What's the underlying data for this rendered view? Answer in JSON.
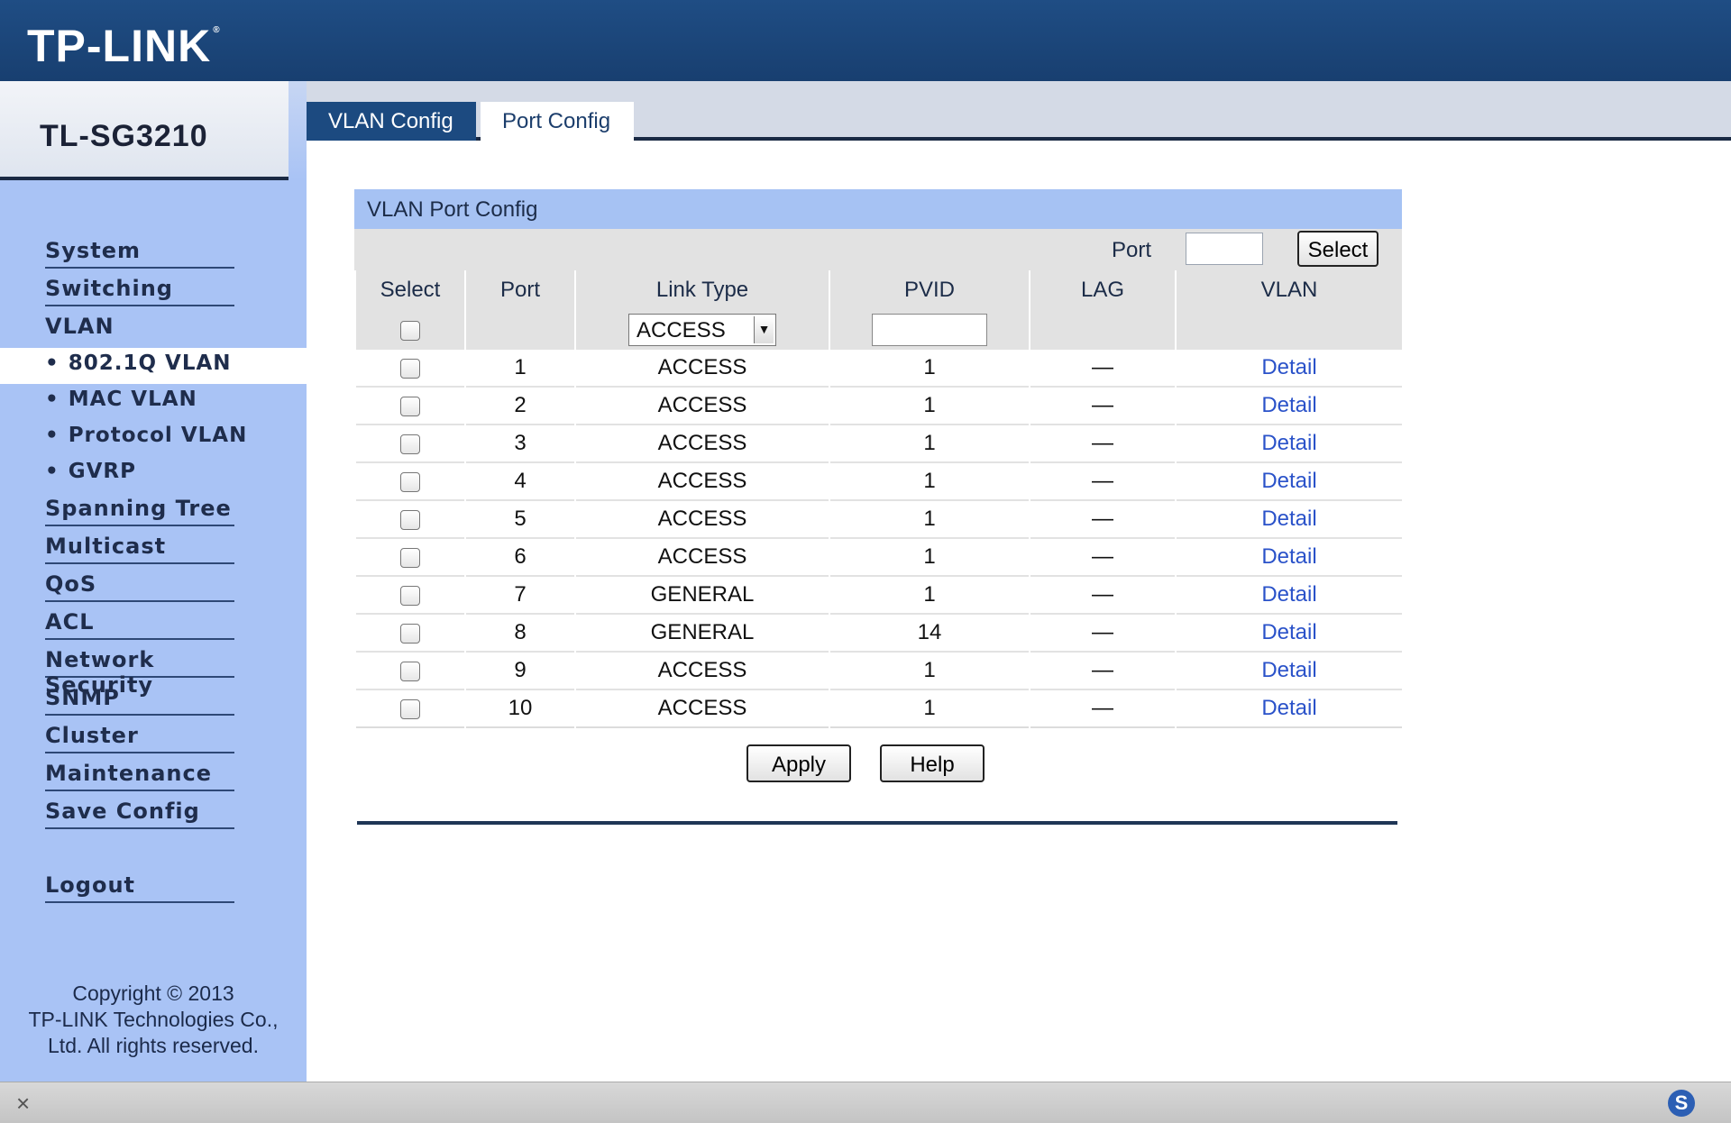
{
  "header": {
    "logo": "TP-LINK",
    "logo_mark": "®"
  },
  "sidebar": {
    "model": "TL-SG3210",
    "items": [
      {
        "label": "System"
      },
      {
        "label": "Switching"
      },
      {
        "label": "VLAN"
      },
      {
        "label": "Spanning Tree"
      },
      {
        "label": "Multicast"
      },
      {
        "label": "QoS"
      },
      {
        "label": "ACL"
      },
      {
        "label": "Network Security"
      },
      {
        "label": "SNMP"
      },
      {
        "label": "Cluster"
      },
      {
        "label": "Maintenance"
      },
      {
        "label": "Save Config"
      },
      {
        "label": "Logout"
      }
    ],
    "subitems": [
      {
        "label": "802.1Q VLAN",
        "active": true
      },
      {
        "label": "MAC VLAN"
      },
      {
        "label": "Protocol VLAN"
      },
      {
        "label": "GVRP"
      }
    ],
    "bullet": "•",
    "copyright": [
      "Copyright © 2013",
      "TP-LINK Technologies Co.,",
      "Ltd. All rights reserved."
    ]
  },
  "tabs": [
    {
      "label": "VLAN Config"
    },
    {
      "label": "Port Config",
      "active": true
    }
  ],
  "panel": {
    "title": "VLAN Port Config",
    "port_label": "Port",
    "port_value": "",
    "select_button": "Select",
    "columns": [
      "Select",
      "Port",
      "Link Type",
      "PVID",
      "LAG",
      "VLAN"
    ],
    "filter": {
      "link_type": "ACCESS",
      "pvid": ""
    },
    "rows": [
      {
        "port": "1",
        "link_type": "ACCESS",
        "pvid": "1",
        "lag": "—",
        "vlan": "Detail"
      },
      {
        "port": "2",
        "link_type": "ACCESS",
        "pvid": "1",
        "lag": "—",
        "vlan": "Detail"
      },
      {
        "port": "3",
        "link_type": "ACCESS",
        "pvid": "1",
        "lag": "—",
        "vlan": "Detail"
      },
      {
        "port": "4",
        "link_type": "ACCESS",
        "pvid": "1",
        "lag": "—",
        "vlan": "Detail"
      },
      {
        "port": "5",
        "link_type": "ACCESS",
        "pvid": "1",
        "lag": "—",
        "vlan": "Detail"
      },
      {
        "port": "6",
        "link_type": "ACCESS",
        "pvid": "1",
        "lag": "—",
        "vlan": "Detail"
      },
      {
        "port": "7",
        "link_type": "GENERAL",
        "pvid": "1",
        "lag": "—",
        "vlan": "Detail"
      },
      {
        "port": "8",
        "link_type": "GENERAL",
        "pvid": "14",
        "lag": "—",
        "vlan": "Detail"
      },
      {
        "port": "9",
        "link_type": "ACCESS",
        "pvid": "1",
        "lag": "—",
        "vlan": "Detail"
      },
      {
        "port": "10",
        "link_type": "ACCESS",
        "pvid": "1",
        "lag": "—",
        "vlan": "Detail"
      }
    ],
    "apply_button": "Apply",
    "help_button": "Help"
  },
  "statusbar": {
    "close_glyph": "×",
    "s_glyph": "S"
  },
  "colors": {
    "header": "#1f4d84",
    "sidebar": "#a9c3f5",
    "panel_title": "#a6c2f3",
    "link": "#2a52c9"
  }
}
